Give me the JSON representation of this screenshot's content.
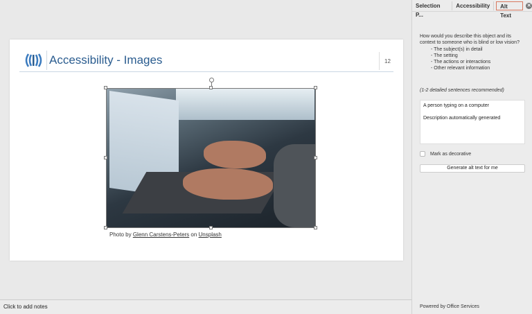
{
  "slide": {
    "title": "Accessibility - Images",
    "page_number": "12",
    "caption": {
      "prefix": "Photo by ",
      "author": "Glenn Carstens-Peters",
      "middle": " on ",
      "source": "Unsplash"
    }
  },
  "notes": {
    "placeholder": "Click to add notes"
  },
  "pane": {
    "tabs": [
      {
        "label": "Selection P..."
      },
      {
        "label": "Accessibility"
      },
      {
        "label": "Alt Text"
      }
    ],
    "active_tab": "Alt Text",
    "description": "How would you describe this object and its context to someone who is blind or low vision?",
    "bullets": [
      "- The subject(s) in detail",
      "- The setting",
      "- The actions or interactions",
      "- Other relevant information"
    ],
    "recommendation": "(1-2 detailed sentences recommended)",
    "alt_text_line1": "A person typing on a computer",
    "alt_text_line2": "Description automatically generated",
    "decorative_label": "Mark as decorative",
    "decorative_checked": false,
    "generate_label": "Generate alt text for me",
    "powered_by": "Powered by Office Services"
  },
  "colors": {
    "title": "#2a5c8f",
    "active_tab_border": "#d9785f"
  }
}
